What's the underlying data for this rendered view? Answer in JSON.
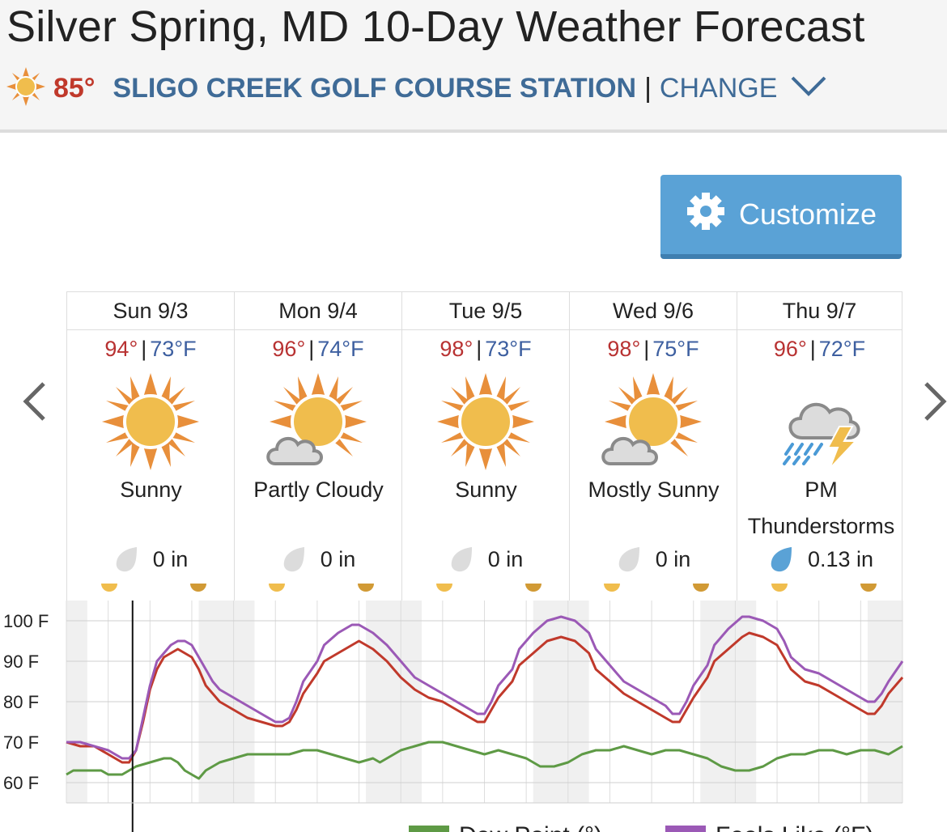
{
  "page": {
    "title": "Silver Spring, MD 10-Day Weather Forecast"
  },
  "station": {
    "current_temp": "85°",
    "name": "SLIGO CREEK GOLF COURSE STATION",
    "separator": "|",
    "change_label": "CHANGE",
    "weather_icon": "sun-icon"
  },
  "toolbar": {
    "customize_label": "Customize"
  },
  "nav": {
    "prev_icon": "chevron-left-icon",
    "next_icon": "chevron-right-icon"
  },
  "days": [
    {
      "name": "Sun 9/3",
      "hi": "94°",
      "lo": "73°F",
      "condition": "Sunny",
      "icon": "sun-icon",
      "precip": "0 in",
      "precip_chance": "none"
    },
    {
      "name": "Mon 9/4",
      "hi": "96°",
      "lo": "74°F",
      "condition": "Partly Cloudy",
      "icon": "partly-cloudy-icon",
      "precip": "0 in",
      "precip_chance": "none"
    },
    {
      "name": "Tue 9/5",
      "hi": "98°",
      "lo": "73°F",
      "condition": "Sunny",
      "icon": "sun-icon",
      "precip": "0 in",
      "precip_chance": "none"
    },
    {
      "name": "Wed 9/6",
      "hi": "98°",
      "lo": "75°F",
      "condition": "Mostly Sunny",
      "icon": "mostly-sunny-icon",
      "precip": "0 in",
      "precip_chance": "none"
    },
    {
      "name": "Thu 9/7",
      "hi": "96°",
      "lo": "72°F",
      "condition": "PM Thunderstorms",
      "icon": "thunderstorm-icon",
      "precip": "0.13 in",
      "precip_chance": "some"
    }
  ],
  "colors": {
    "temperature": "#c0392b",
    "feels_like": "#9b59b6",
    "dew_point": "#5e9a45",
    "station_blue": "#3f6b97",
    "button_blue": "#5aa2d6"
  },
  "chart_data": {
    "type": "line",
    "y_ticks": [
      "100 F",
      "90 F",
      "80 F",
      "70 F",
      "60 F"
    ],
    "ylim": [
      55,
      105
    ],
    "x_hours": [
      0,
      120
    ],
    "current_hour": 9.5,
    "legend": [
      "Dew Point (°)",
      "Feels Like (°F)"
    ],
    "series": [
      {
        "key": "temp",
        "color": "#c0392b",
        "points": [
          [
            0,
            70
          ],
          [
            2,
            69
          ],
          [
            4,
            69
          ],
          [
            6,
            67
          ],
          [
            8,
            65
          ],
          [
            9,
            65
          ],
          [
            10,
            68
          ],
          [
            11,
            75
          ],
          [
            12,
            83
          ],
          [
            13,
            88
          ],
          [
            14,
            91
          ],
          [
            15,
            92
          ],
          [
            16,
            93
          ],
          [
            17,
            92
          ],
          [
            18,
            91
          ],
          [
            19,
            88
          ],
          [
            20,
            84
          ],
          [
            21,
            82
          ],
          [
            22,
            80
          ],
          [
            23,
            79
          ],
          [
            24,
            78
          ],
          [
            26,
            76
          ],
          [
            28,
            75
          ],
          [
            30,
            74
          ],
          [
            31,
            74
          ],
          [
            32,
            75
          ],
          [
            33,
            78
          ],
          [
            34,
            82
          ],
          [
            36,
            87
          ],
          [
            37,
            90
          ],
          [
            39,
            92
          ],
          [
            41,
            94
          ],
          [
            42,
            95
          ],
          [
            44,
            93
          ],
          [
            46,
            90
          ],
          [
            48,
            86
          ],
          [
            50,
            83
          ],
          [
            52,
            81
          ],
          [
            54,
            80
          ],
          [
            56,
            78
          ],
          [
            58,
            76
          ],
          [
            59,
            75
          ],
          [
            60,
            75
          ],
          [
            61,
            78
          ],
          [
            62,
            81
          ],
          [
            64,
            85
          ],
          [
            65,
            89
          ],
          [
            67,
            92
          ],
          [
            69,
            95
          ],
          [
            71,
            96
          ],
          [
            73,
            95
          ],
          [
            75,
            92
          ],
          [
            76,
            88
          ],
          [
            78,
            85
          ],
          [
            80,
            82
          ],
          [
            82,
            80
          ],
          [
            84,
            78
          ],
          [
            86,
            76
          ],
          [
            87,
            75
          ],
          [
            88,
            75
          ],
          [
            89,
            78
          ],
          [
            90,
            81
          ],
          [
            92,
            86
          ],
          [
            93,
            90
          ],
          [
            95,
            93
          ],
          [
            97,
            96
          ],
          [
            98,
            97
          ],
          [
            100,
            96
          ],
          [
            102,
            94
          ],
          [
            103,
            91
          ],
          [
            104,
            88
          ],
          [
            106,
            85
          ],
          [
            108,
            84
          ],
          [
            110,
            82
          ],
          [
            112,
            80
          ],
          [
            114,
            78
          ],
          [
            115,
            77
          ],
          [
            116,
            77
          ],
          [
            117,
            79
          ],
          [
            118,
            82
          ],
          [
            120,
            86
          ]
        ]
      },
      {
        "key": "feels",
        "color": "#9b59b6",
        "points": [
          [
            0,
            70
          ],
          [
            2,
            70
          ],
          [
            4,
            69
          ],
          [
            6,
            68
          ],
          [
            8,
            66
          ],
          [
            9,
            66
          ],
          [
            10,
            68
          ],
          [
            11,
            76
          ],
          [
            12,
            84
          ],
          [
            13,
            90
          ],
          [
            14,
            92
          ],
          [
            15,
            94
          ],
          [
            16,
            95
          ],
          [
            17,
            95
          ],
          [
            18,
            94
          ],
          [
            19,
            91
          ],
          [
            20,
            88
          ],
          [
            21,
            85
          ],
          [
            22,
            83
          ],
          [
            23,
            82
          ],
          [
            24,
            81
          ],
          [
            26,
            79
          ],
          [
            28,
            77
          ],
          [
            30,
            75
          ],
          [
            31,
            75
          ],
          [
            32,
            76
          ],
          [
            33,
            80
          ],
          [
            34,
            85
          ],
          [
            36,
            90
          ],
          [
            37,
            94
          ],
          [
            39,
            97
          ],
          [
            41,
            99
          ],
          [
            42,
            99
          ],
          [
            44,
            97
          ],
          [
            46,
            94
          ],
          [
            48,
            90
          ],
          [
            50,
            86
          ],
          [
            52,
            84
          ],
          [
            54,
            82
          ],
          [
            56,
            80
          ],
          [
            58,
            78
          ],
          [
            59,
            77
          ],
          [
            60,
            77
          ],
          [
            61,
            80
          ],
          [
            62,
            84
          ],
          [
            64,
            88
          ],
          [
            65,
            93
          ],
          [
            67,
            97
          ],
          [
            69,
            100
          ],
          [
            71,
            101
          ],
          [
            73,
            100
          ],
          [
            75,
            97
          ],
          [
            76,
            93
          ],
          [
            78,
            89
          ],
          [
            80,
            85
          ],
          [
            82,
            83
          ],
          [
            84,
            81
          ],
          [
            86,
            79
          ],
          [
            87,
            77
          ],
          [
            88,
            77
          ],
          [
            89,
            80
          ],
          [
            90,
            84
          ],
          [
            92,
            89
          ],
          [
            93,
            94
          ],
          [
            95,
            98
          ],
          [
            97,
            101
          ],
          [
            98,
            101
          ],
          [
            100,
            100
          ],
          [
            102,
            98
          ],
          [
            103,
            95
          ],
          [
            104,
            91
          ],
          [
            106,
            88
          ],
          [
            108,
            87
          ],
          [
            110,
            85
          ],
          [
            112,
            83
          ],
          [
            114,
            81
          ],
          [
            115,
            80
          ],
          [
            116,
            80
          ],
          [
            117,
            82
          ],
          [
            118,
            85
          ],
          [
            120,
            90
          ]
        ]
      },
      {
        "key": "dew",
        "color": "#5e9a45",
        "points": [
          [
            0,
            62
          ],
          [
            1,
            63
          ],
          [
            3,
            63
          ],
          [
            5,
            63
          ],
          [
            6,
            62
          ],
          [
            8,
            62
          ],
          [
            10,
            64
          ],
          [
            12,
            65
          ],
          [
            14,
            66
          ],
          [
            15,
            66
          ],
          [
            16,
            65
          ],
          [
            17,
            63
          ],
          [
            18,
            62
          ],
          [
            19,
            61
          ],
          [
            20,
            63
          ],
          [
            21,
            64
          ],
          [
            22,
            65
          ],
          [
            24,
            66
          ],
          [
            26,
            67
          ],
          [
            28,
            67
          ],
          [
            30,
            67
          ],
          [
            32,
            67
          ],
          [
            34,
            68
          ],
          [
            36,
            68
          ],
          [
            38,
            67
          ],
          [
            40,
            66
          ],
          [
            42,
            65
          ],
          [
            44,
            66
          ],
          [
            45,
            65
          ],
          [
            46,
            66
          ],
          [
            48,
            68
          ],
          [
            50,
            69
          ],
          [
            52,
            70
          ],
          [
            54,
            70
          ],
          [
            56,
            69
          ],
          [
            58,
            68
          ],
          [
            60,
            67
          ],
          [
            62,
            68
          ],
          [
            64,
            67
          ],
          [
            66,
            66
          ],
          [
            68,
            64
          ],
          [
            70,
            64
          ],
          [
            72,
            65
          ],
          [
            74,
            67
          ],
          [
            76,
            68
          ],
          [
            78,
            68
          ],
          [
            80,
            69
          ],
          [
            82,
            68
          ],
          [
            84,
            67
          ],
          [
            86,
            68
          ],
          [
            88,
            68
          ],
          [
            90,
            67
          ],
          [
            92,
            66
          ],
          [
            94,
            64
          ],
          [
            96,
            63
          ],
          [
            98,
            63
          ],
          [
            100,
            64
          ],
          [
            102,
            66
          ],
          [
            104,
            67
          ],
          [
            106,
            67
          ],
          [
            108,
            68
          ],
          [
            110,
            68
          ],
          [
            112,
            67
          ],
          [
            114,
            68
          ],
          [
            116,
            68
          ],
          [
            118,
            67
          ],
          [
            120,
            69
          ]
        ]
      }
    ]
  }
}
